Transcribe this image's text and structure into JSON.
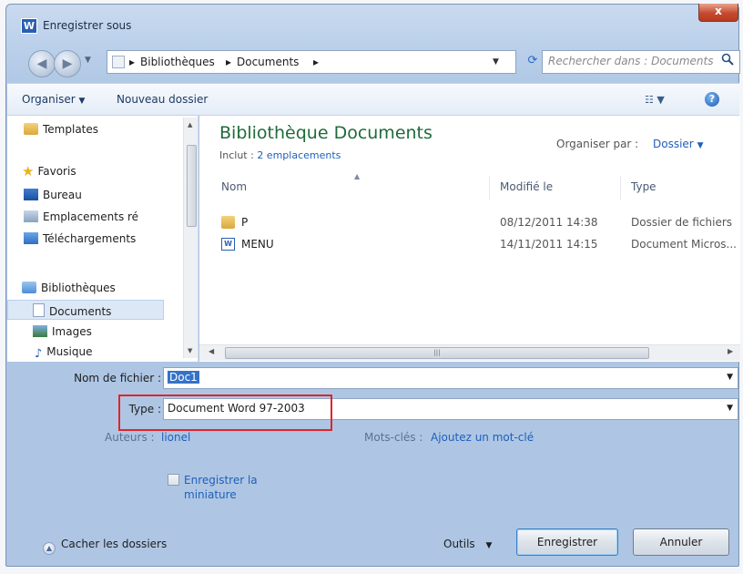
{
  "window": {
    "title": "Enregistrer sous",
    "app_icon": "W",
    "close_label": "x"
  },
  "address": {
    "crumbs": [
      "Bibliothèques",
      "Documents"
    ],
    "search_placeholder": "Rechercher dans : Documents"
  },
  "toolbar": {
    "organize": "Organiser",
    "new_folder": "Nouveau dossier"
  },
  "navpane": {
    "items": [
      {
        "label": "Templates",
        "icon": "folder-icon"
      },
      {
        "label": "Favoris",
        "icon": "star-icon"
      },
      {
        "label": "Bureau",
        "icon": "desktop-icon"
      },
      {
        "label": "Emplacements ré",
        "icon": "places-icon"
      },
      {
        "label": "Téléchargements",
        "icon": "download-icon"
      },
      {
        "label": "Bibliothèques",
        "icon": "library-icon"
      },
      {
        "label": "Documents",
        "icon": "doc-icon",
        "selected": true
      },
      {
        "label": "Images",
        "icon": "image-icon"
      },
      {
        "label": "Musique",
        "icon": "music-icon"
      }
    ]
  },
  "library": {
    "title": "Bibliothèque Documents",
    "includes_label": "Inclut :",
    "includes_link": "2 emplacements",
    "arrange_label": "Organiser par :",
    "arrange_value": "Dossier"
  },
  "columns": {
    "name": "Nom",
    "modified": "Modifié le",
    "type": "Type"
  },
  "files": [
    {
      "name": "P",
      "date": "08/12/2011 14:38",
      "type": "Dossier de fichiers",
      "icon": "folder-icon"
    },
    {
      "name": "MENU",
      "date": "14/11/2011 14:15",
      "type": "Document Micros...",
      "icon": "word-doc-icon"
    }
  ],
  "form": {
    "filename_label": "Nom de fichier :",
    "filename_value": "Doc1",
    "type_label": "Type :",
    "type_value": "Document Word 97-2003",
    "authors_label": "Auteurs :",
    "authors_value": "lionel",
    "keywords_label": "Mots-clés :",
    "keywords_value": "Ajoutez un mot-clé",
    "thumbnail_label": "Enregistrer la miniature"
  },
  "footer": {
    "hide_folders": "Cacher les dossiers",
    "tools": "Outils",
    "save": "Enregistrer",
    "cancel": "Annuler"
  },
  "colors": {
    "highlight_box": "#e0242b",
    "library_title": "#1f6b3a",
    "link": "#1f5fb8"
  }
}
